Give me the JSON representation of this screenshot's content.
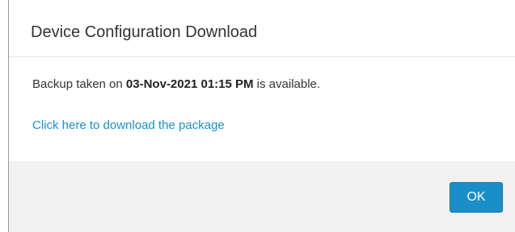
{
  "dialog": {
    "title": "Device Configuration Download",
    "message": {
      "prefix": "Backup taken on ",
      "timestamp": "03-Nov-2021 01:15 PM",
      "suffix": " is available."
    },
    "download_link": "Click here to download the package",
    "ok_label": "OK"
  },
  "colors": {
    "link": "#1a8fd1",
    "primary_button": "#1a8ec9",
    "footer_background": "#f1f1f1"
  }
}
